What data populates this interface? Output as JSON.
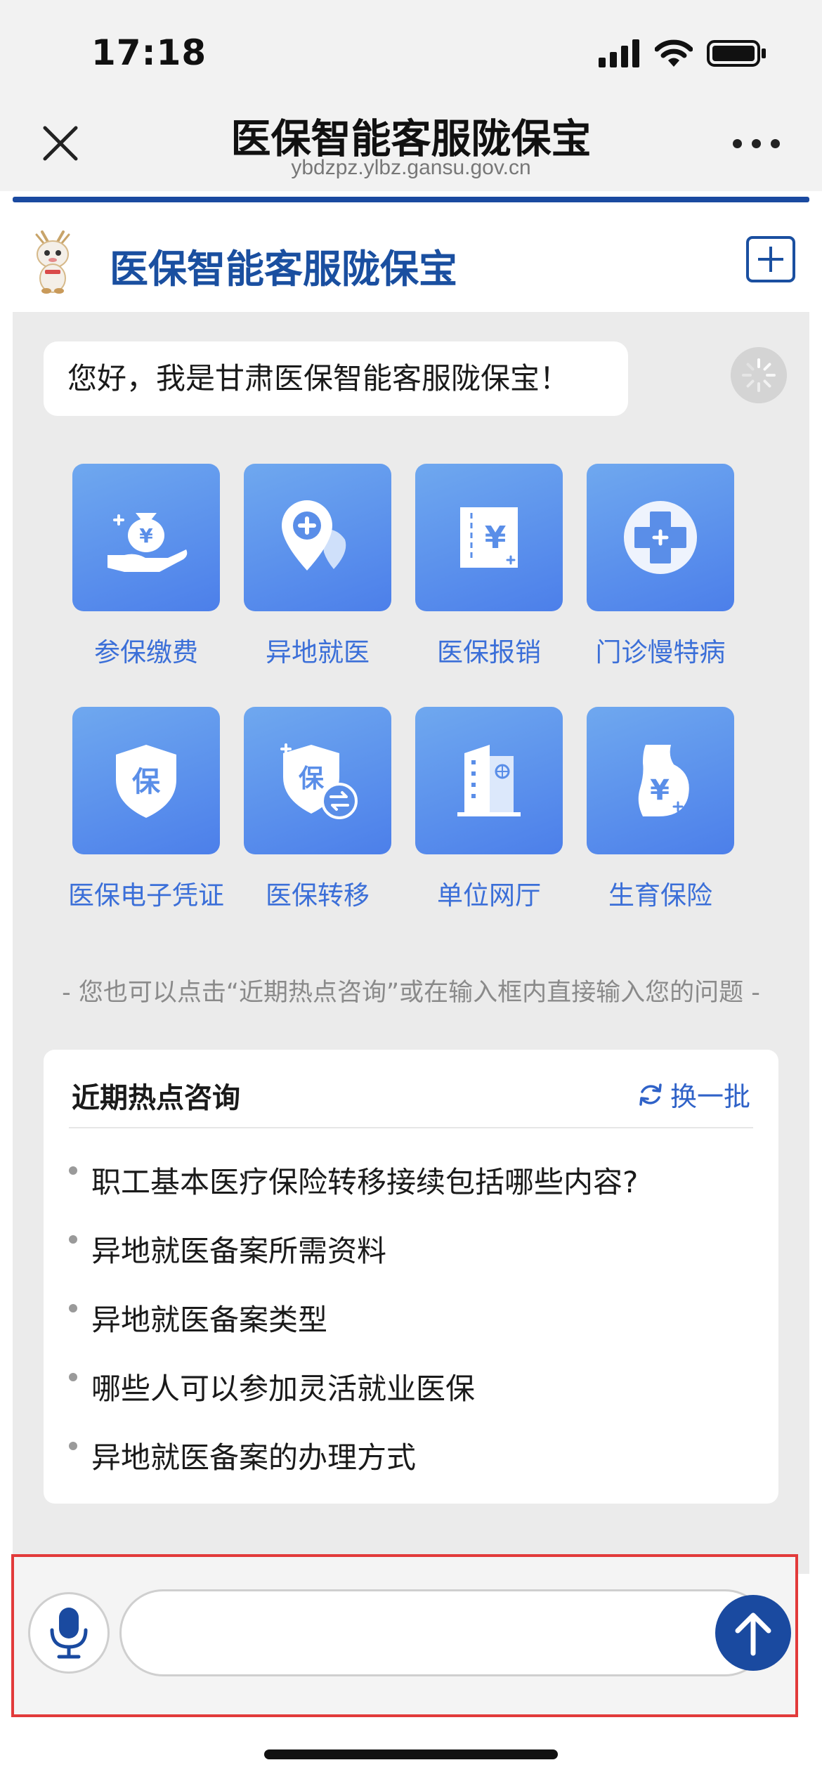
{
  "status_bar": {
    "time": "17:18"
  },
  "nav": {
    "title": "医保智能客服陇保宝",
    "url": "ybdzpz.ylbz.gansu.gov.cn"
  },
  "app_header": {
    "title": "医保智能客服陇保宝"
  },
  "chat": {
    "greeting": "您好，我是甘肃医保智能客服陇保宝！",
    "services": [
      {
        "label": "参保缴费",
        "icon": "money-bag-hand-icon"
      },
      {
        "label": "异地就医",
        "icon": "medical-location-icon"
      },
      {
        "label": "医保报销",
        "icon": "reimbursement-receipt-icon"
      },
      {
        "label": "门诊慢特病",
        "icon": "medical-cross-icon"
      },
      {
        "label": "医保电子凭证",
        "icon": "shield-bao-icon"
      },
      {
        "label": "医保转移",
        "icon": "shield-transfer-icon"
      },
      {
        "label": "单位网厅",
        "icon": "office-building-icon"
      },
      {
        "label": "生育保险",
        "icon": "maternity-icon"
      }
    ],
    "hint": "- 您也可以点击“近期热点咨询”或在输入框内直接输入您的问题 -"
  },
  "hot_topics": {
    "title": "近期热点咨询",
    "refresh_label": "换一批",
    "items": [
      "职工基本医疗保险转移接续包括哪些内容?",
      "异地就医备案所需资料",
      "异地就医备案类型",
      "哪些人可以参加灵活就业医保",
      "异地就医备案的办理方式"
    ]
  },
  "input": {
    "placeholder": ""
  },
  "colors": {
    "primary": "#1a4aa0",
    "tile_gradient_top": "#6fa8ef",
    "tile_gradient_bottom": "#4c7fea",
    "highlight_frame": "#e23a3a"
  }
}
